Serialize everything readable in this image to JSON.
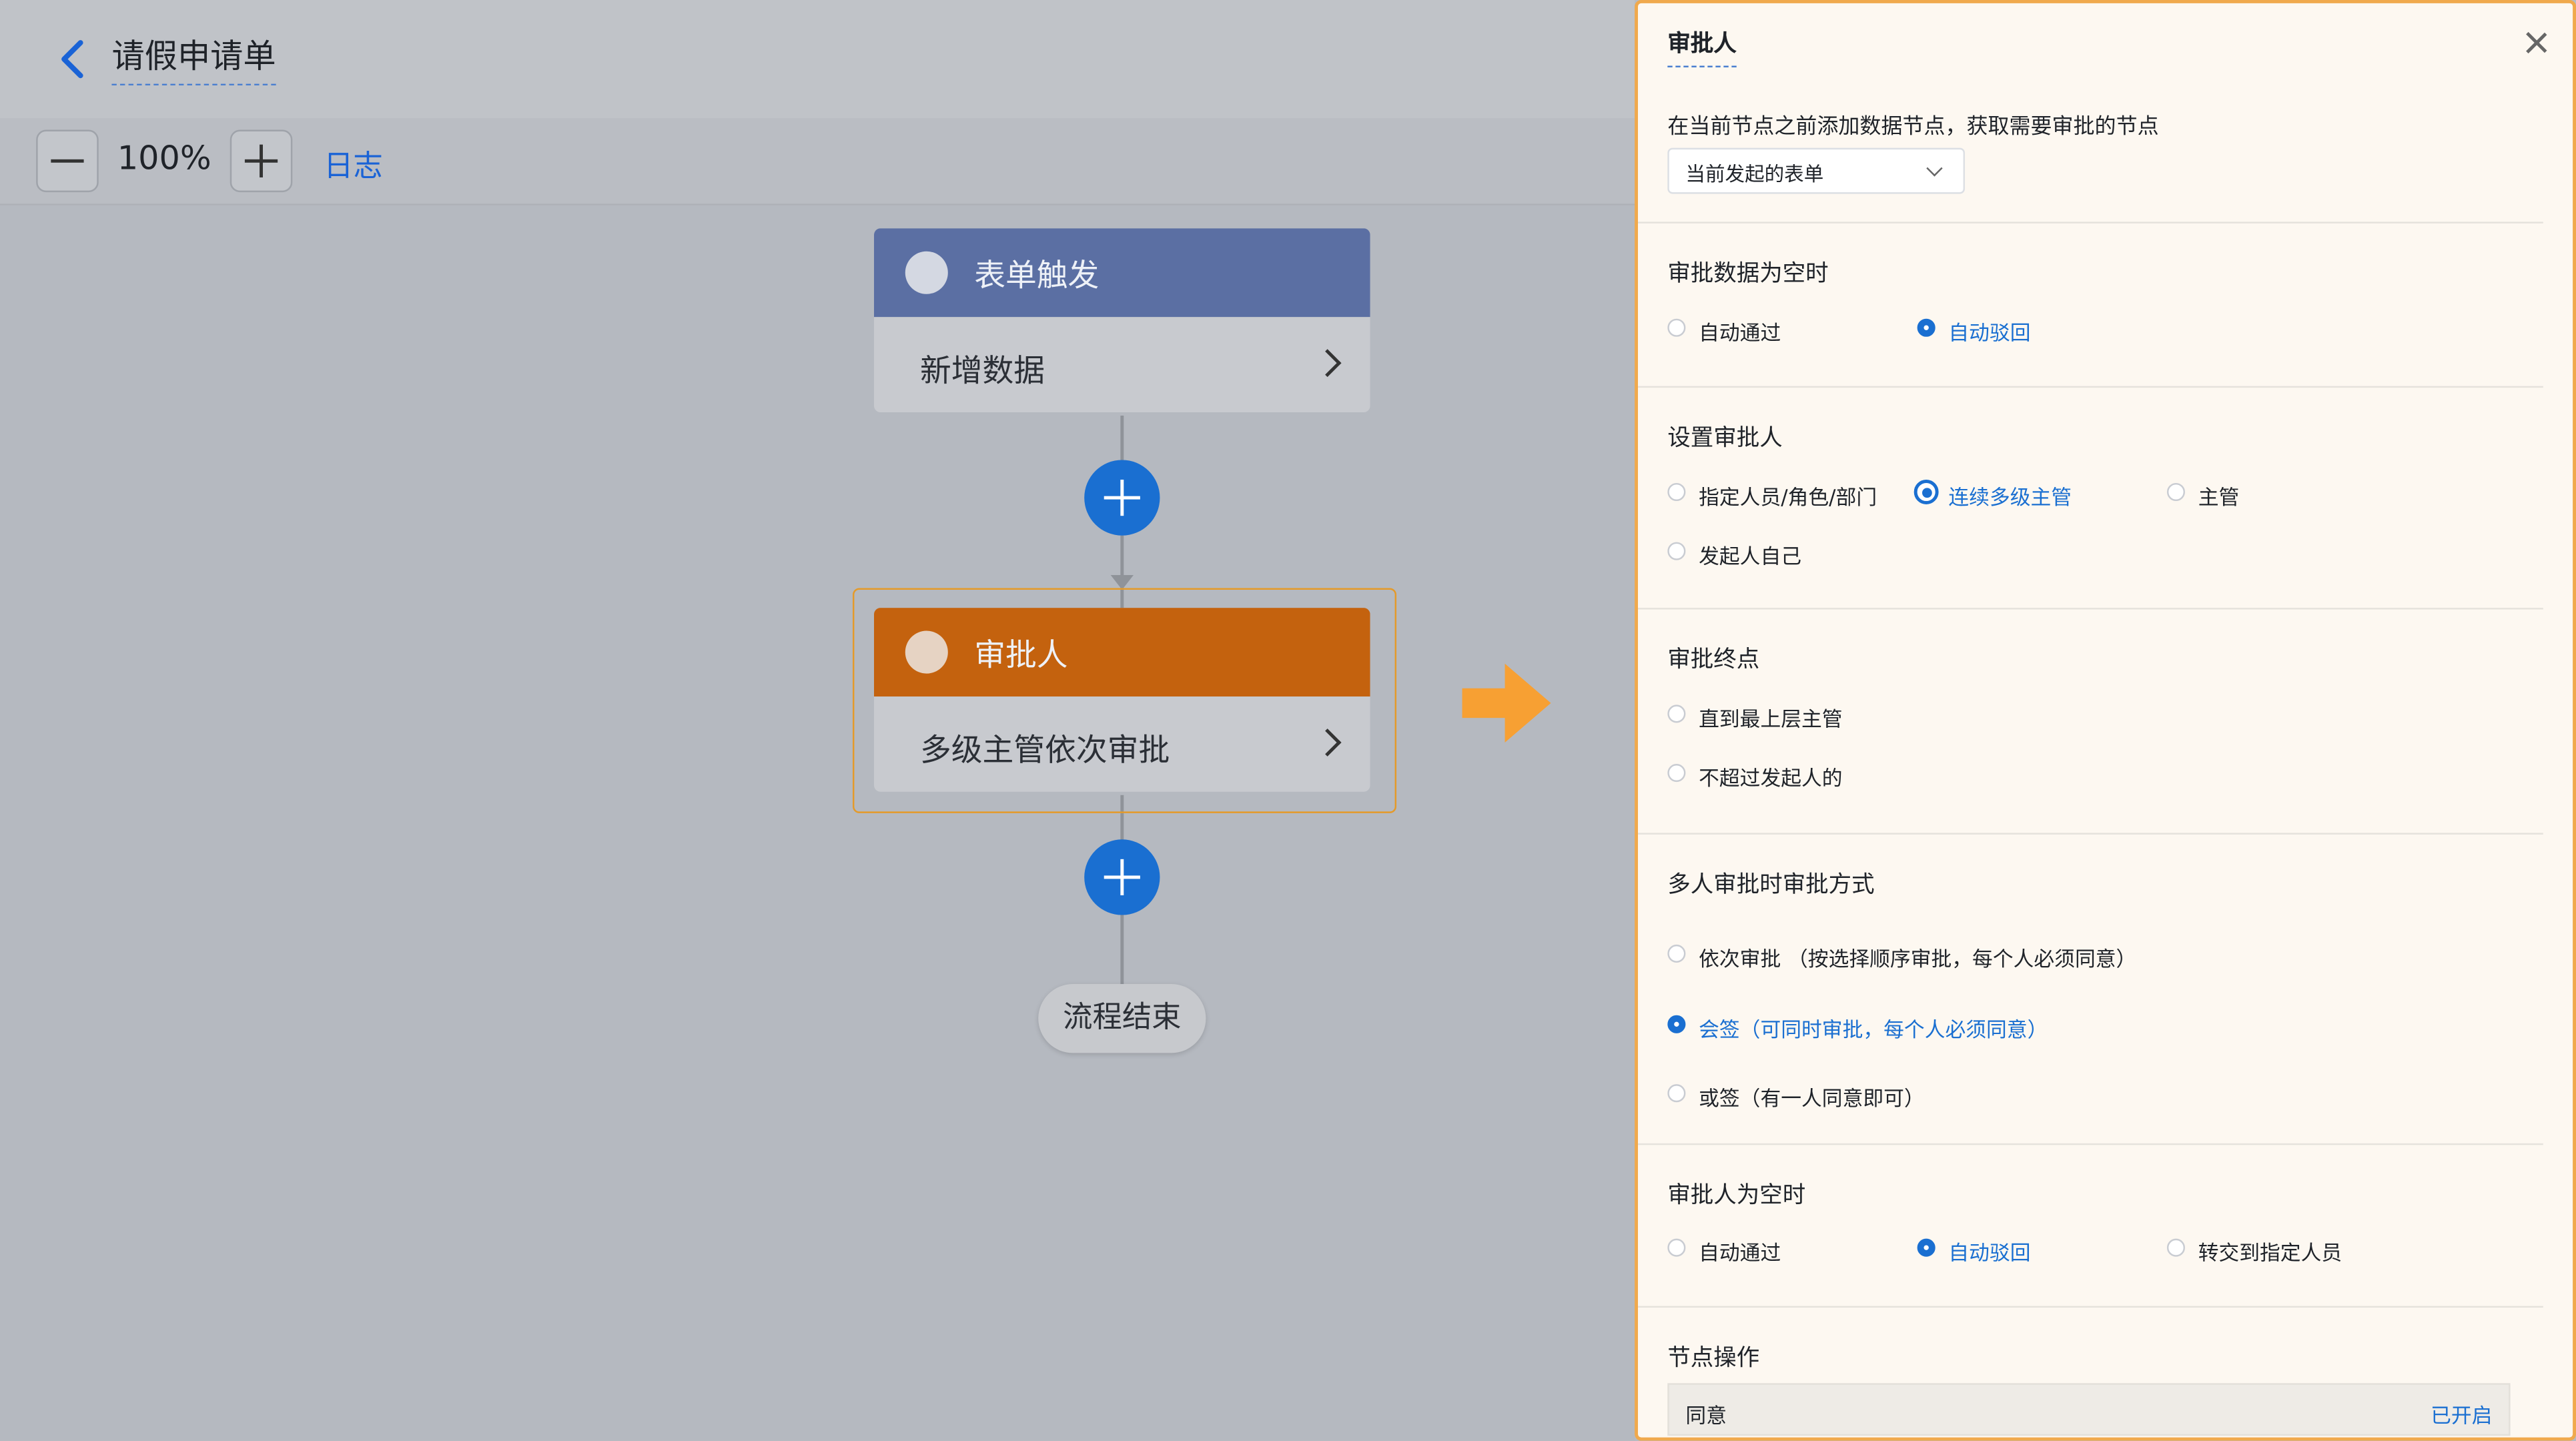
{
  "header": {
    "title": "请假申请单"
  },
  "toolbar": {
    "zoom": "100%",
    "log_label": "日志"
  },
  "flow": {
    "trigger": {
      "title": "表单触发",
      "detail": "新增数据"
    },
    "approver": {
      "title": "审批人",
      "detail": "多级主管依次审批"
    },
    "end_label": "流程结束"
  },
  "panel": {
    "title": "审批人",
    "data_node_hint": "在当前节点之前添加数据节点，获取需要审批的节点",
    "data_node_select": "当前发起的表单",
    "empty_data": {
      "label": "审批数据为空时",
      "options": [
        "自动通过",
        "自动驳回"
      ],
      "selected": "自动驳回"
    },
    "set_approver": {
      "label": "设置审批人",
      "options": [
        "指定人员/角色/部门",
        "连续多级主管",
        "主管",
        "发起人自己"
      ],
      "selected": "连续多级主管"
    },
    "end_point": {
      "label": "审批终点",
      "options": [
        "直到最上层主管",
        "不超过发起人的"
      ]
    },
    "multi_mode": {
      "label": "多人审批时审批方式",
      "options": [
        "依次审批 （按选择顺序审批，每个人必须同意）",
        "会签（可同时审批，每个人必须同意）",
        "或签（有一人同意即可）"
      ],
      "selected": "会签（可同时审批，每个人必须同意）"
    },
    "empty_approver": {
      "label": "审批人为空时",
      "options": [
        "自动通过",
        "自动驳回",
        "转交到指定人员"
      ],
      "selected": "自动驳回"
    },
    "node_ops": {
      "label": "节点操作",
      "row_label": "同意",
      "row_status": "已开启"
    }
  },
  "colors": {
    "accent": "#1a6fd1",
    "trigger_header": "#5b6fa3",
    "approver_header": "#c4620e",
    "selection_border": "#f0a94d",
    "arrow": "#f7a033"
  }
}
